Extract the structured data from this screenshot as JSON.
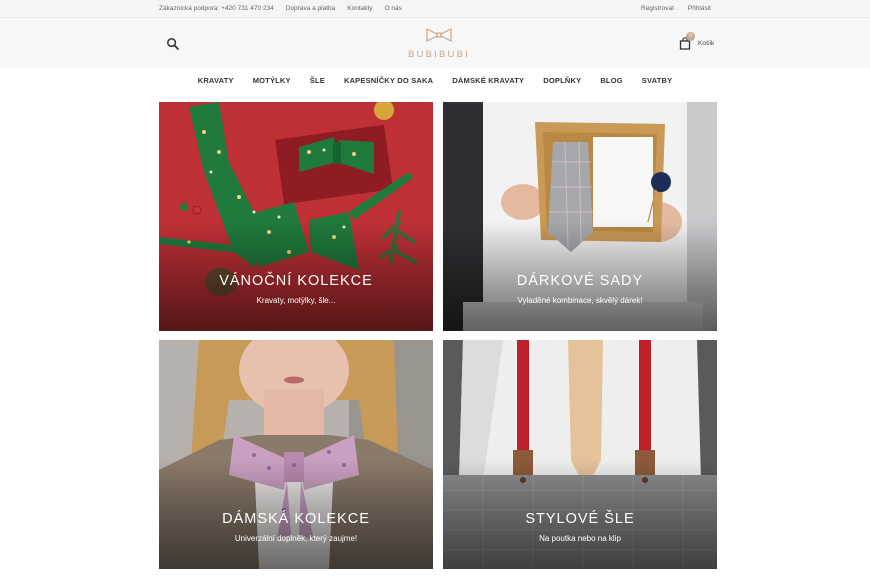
{
  "topbar": {
    "support": "Zákaznická podpora: +420 731 470 234",
    "links": [
      "Doprava a platba",
      "Kontakty",
      "O nás"
    ],
    "register": "Registrovat",
    "login": "Přihlásit"
  },
  "header": {
    "logo_text": "BUBIBUBI",
    "cart_label": "Košík",
    "cart_count": "0"
  },
  "nav": {
    "items": [
      "KRAVATY",
      "MOTÝLKY",
      "ŠLE",
      "KAPESNÍČKY DO SAKA",
      "DÁMSKÉ KRAVATY",
      "DOPLŇKY",
      "BLOG",
      "SVATBY"
    ]
  },
  "tiles": [
    {
      "title": "VÁNOČNÍ KOLEKCE",
      "subtitle": "Kravaty, motýlky, šle..."
    },
    {
      "title": "DÁRKOVÉ SADY",
      "subtitle": "Vyladěné kombinace, skvělý dárek!"
    },
    {
      "title": "DÁMSKÁ KOLEKCE",
      "subtitle": "Univerzální doplněk, který zaujme!"
    },
    {
      "title": "STYLOVÉ ŠLE",
      "subtitle": "Na poutka nebo na klip"
    }
  ],
  "colors": {
    "brand": "#c8a88e",
    "christmas_bg": "#c7343a",
    "christmas_green": "#1f7a3c"
  }
}
